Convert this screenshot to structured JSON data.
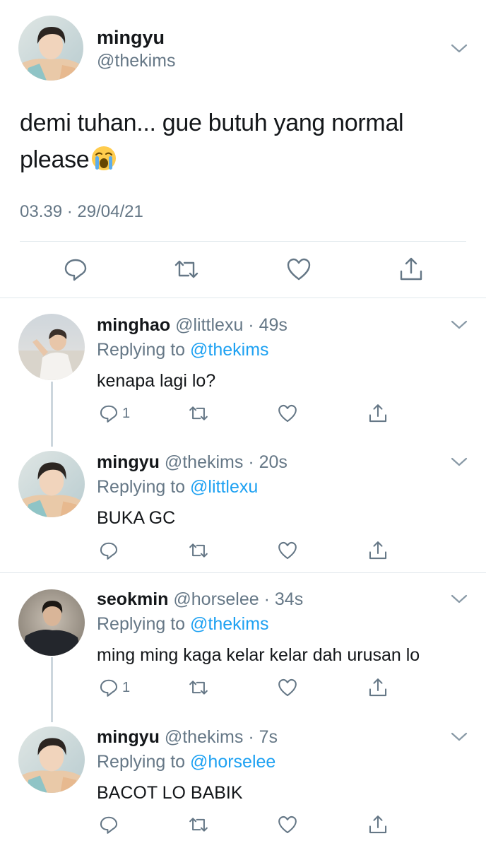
{
  "main": {
    "name": "mingyu",
    "handle": "@thekims",
    "text": "demi tuhan... gue butuh yang normal please",
    "time": "03.39 · 29/04/21"
  },
  "replies": [
    {
      "name": "minghao",
      "meta": "@littlexu · 49s",
      "replying_label": "Replying to",
      "mention": "@thekims",
      "text": "kenapa lagi lo?",
      "reply_count": "1"
    },
    {
      "name": "mingyu",
      "meta": "@thekims · 20s",
      "replying_label": "Replying to",
      "mention": "@littlexu",
      "text": "BUKA GC",
      "reply_count": ""
    },
    {
      "name": "seokmin",
      "meta": "@horselee · 34s",
      "replying_label": "Replying to",
      "mention": "@thekims",
      "text": "ming ming kaga kelar kelar dah urusan lo",
      "reply_count": "1"
    },
    {
      "name": "mingyu",
      "meta": "@thekims · 7s",
      "replying_label": "Replying to",
      "mention": "@horselee",
      "text": "BACOT LO BABIK",
      "reply_count": ""
    }
  ],
  "icons": {
    "chevron": "chevron-down-icon",
    "reply": "reply-icon",
    "retweet": "retweet-icon",
    "like": "heart-icon",
    "share": "share-icon",
    "emoji": "loudly-crying-face-emoji"
  },
  "colors": {
    "text": "#14171a",
    "secondary": "#657786",
    "link": "#1da1f2",
    "divider": "#e1e8ed",
    "thread_line": "#ccd6dd"
  }
}
